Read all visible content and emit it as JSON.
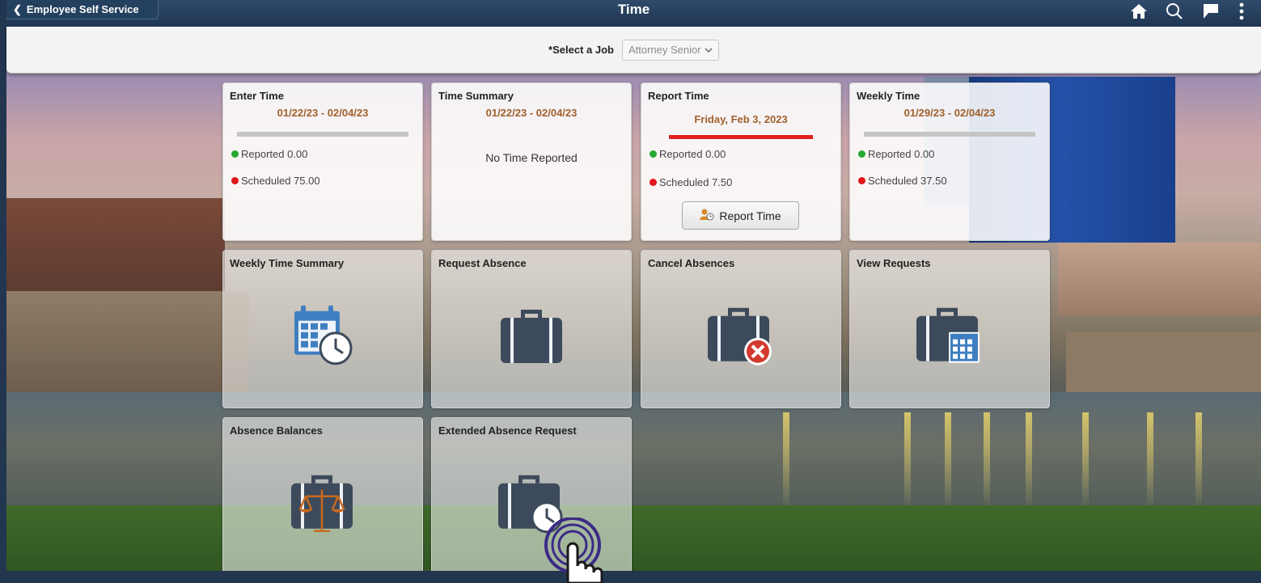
{
  "header": {
    "back_label": "Employee Self Service",
    "title": "Time",
    "icons": [
      "home-icon",
      "search-icon",
      "notifications-icon",
      "actions-menu-icon"
    ]
  },
  "job_selector": {
    "label": "*Select a Job",
    "value": "Attorney Senior"
  },
  "tiles": {
    "enter_time": {
      "title": "Enter Time",
      "dates": "01/22/23 - 02/04/23",
      "reported": "Reported 0.00",
      "scheduled": "Scheduled 75.00"
    },
    "time_summary": {
      "title": "Time Summary",
      "dates": "01/22/23 - 02/04/23",
      "message": "No Time Reported"
    },
    "report_time": {
      "title": "Report Time",
      "date": "Friday, Feb 3, 2023",
      "reported": "Reported 0.00",
      "scheduled": "Scheduled 7.50",
      "button_label": "Report Time"
    },
    "weekly_time": {
      "title": "Weekly Time",
      "dates": "01/29/23 - 02/04/23",
      "reported": "Reported 0.00",
      "scheduled": "Scheduled 37.50"
    },
    "weekly_time_summary": {
      "title": "Weekly Time Summary",
      "icon": "calendar-clock-icon"
    },
    "request_absence": {
      "title": "Request Absence",
      "icon": "briefcase-icon"
    },
    "cancel_absences": {
      "title": "Cancel Absences",
      "icon": "briefcase-cancel-icon"
    },
    "view_requests": {
      "title": "View Requests",
      "icon": "briefcase-calendar-icon"
    },
    "absence_balances": {
      "title": "Absence Balances",
      "icon": "briefcase-scales-icon"
    },
    "extended_absence_request": {
      "title": "Extended Absence Request",
      "icon": "briefcase-clock-icon"
    }
  },
  "colors": {
    "header_bg": "#22364f",
    "date_text": "#a0612b",
    "reported_dot": "#26a832",
    "scheduled_dot": "#e3161b",
    "icon_dark": "#3d4a5c",
    "icon_blue": "#3f7fc1"
  }
}
